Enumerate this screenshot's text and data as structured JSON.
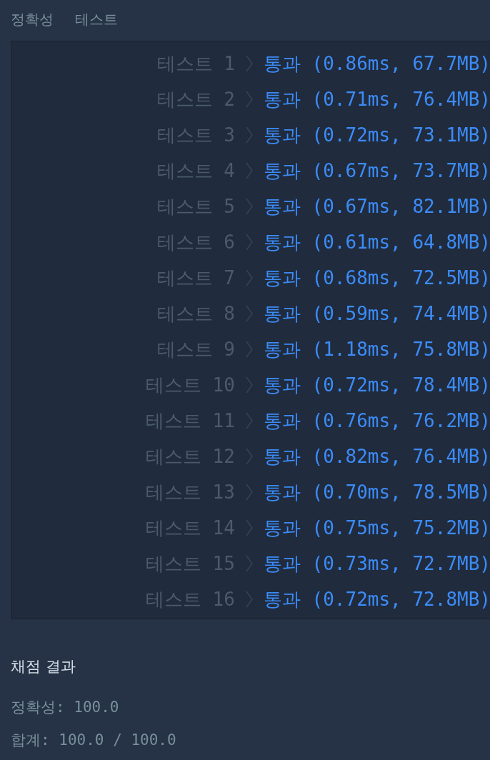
{
  "heading": [
    "정확성",
    "테스트"
  ],
  "tests": [
    {
      "label": "테스트 1",
      "result": "통과 (0.86ms, 67.7MB)",
      "passed": true
    },
    {
      "label": "테스트 2",
      "result": "통과 (0.71ms, 76.4MB)",
      "passed": true
    },
    {
      "label": "테스트 3",
      "result": "통과 (0.72ms, 73.1MB)",
      "passed": true
    },
    {
      "label": "테스트 4",
      "result": "통과 (0.67ms, 73.7MB)",
      "passed": true
    },
    {
      "label": "테스트 5",
      "result": "통과 (0.67ms, 82.1MB)",
      "passed": true
    },
    {
      "label": "테스트 6",
      "result": "통과 (0.61ms, 64.8MB)",
      "passed": true
    },
    {
      "label": "테스트 7",
      "result": "통과 (0.68ms, 72.5MB)",
      "passed": true
    },
    {
      "label": "테스트 8",
      "result": "통과 (0.59ms, 74.4MB)",
      "passed": true
    },
    {
      "label": "테스트 9",
      "result": "통과 (1.18ms, 75.8MB)",
      "passed": true
    },
    {
      "label": "테스트 10",
      "result": "통과 (0.72ms, 78.4MB)",
      "passed": true
    },
    {
      "label": "테스트 11",
      "result": "통과 (0.76ms, 76.2MB)",
      "passed": true
    },
    {
      "label": "테스트 12",
      "result": "통과 (0.82ms, 76.4MB)",
      "passed": true
    },
    {
      "label": "테스트 13",
      "result": "통과 (0.70ms, 78.5MB)",
      "passed": true
    },
    {
      "label": "테스트 14",
      "result": "통과 (0.75ms, 75.2MB)",
      "passed": true
    },
    {
      "label": "테스트 15",
      "result": "통과 (0.73ms, 72.7MB)",
      "passed": true
    },
    {
      "label": "테스트 16",
      "result": "통과 (0.72ms, 72.8MB)",
      "passed": true
    }
  ],
  "summary": {
    "title": "채점 결과",
    "lines": [
      "정확성: 100.0",
      "합계: 100.0 / 100.0"
    ]
  }
}
